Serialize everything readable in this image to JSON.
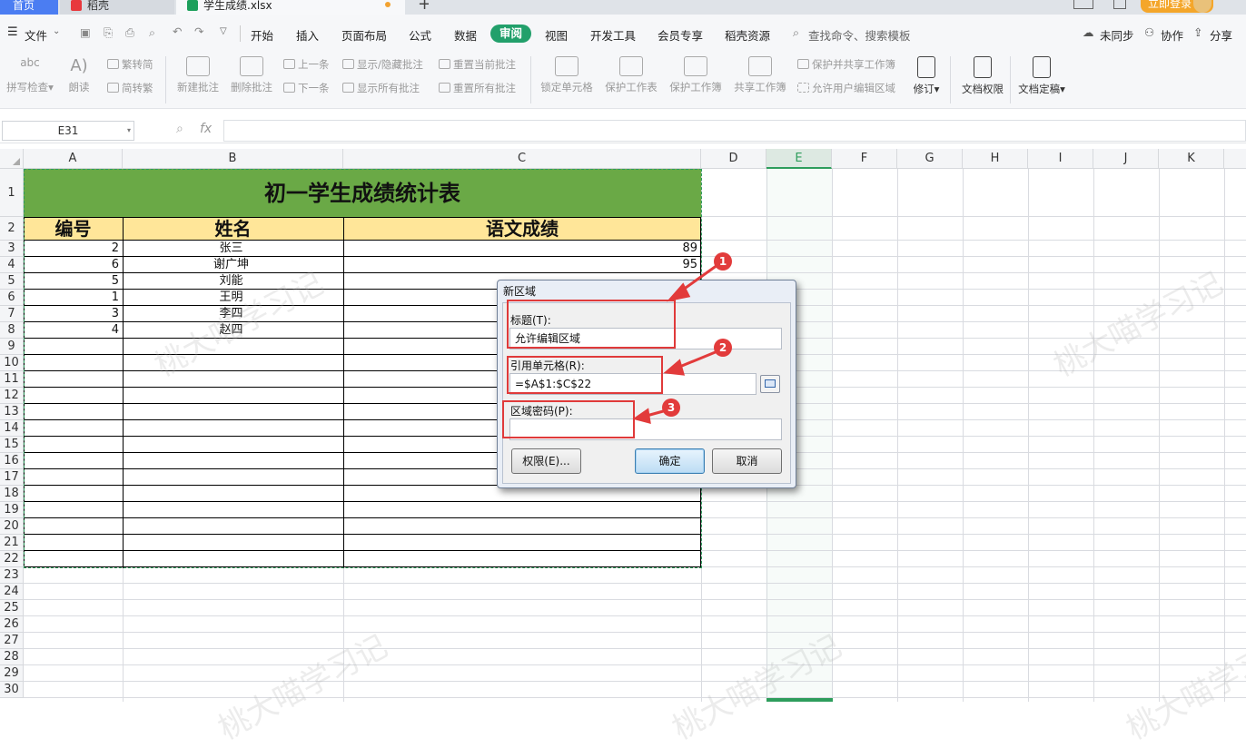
{
  "tabs": {
    "home": "首页",
    "daoke": "稻壳",
    "file": "学生成绩.xlsx",
    "plus": "+"
  },
  "login": "立即登录",
  "menu": {
    "file": "文件",
    "items": [
      "开始",
      "插入",
      "页面布局",
      "公式",
      "数据",
      "审阅",
      "视图",
      "开发工具",
      "会员专享",
      "稻壳资源"
    ],
    "search": "查找命令、搜索模板",
    "sync": "未同步",
    "collab": "协作",
    "share": "分享"
  },
  "ribbon": {
    "spell": "拼写检查",
    "read": "朗读",
    "t2s": "繁转简",
    "s2t": "简转繁",
    "new_comment": "新建批注",
    "del_comment": "删除批注",
    "prev": "上一条",
    "next": "下一条",
    "show_hide": "显示/隐藏批注",
    "show_all": "显示所有批注",
    "reset_cur": "重置当前批注",
    "reset_all": "重置所有批注",
    "lock_cell": "锁定单元格",
    "protect_sheet": "保护工作表",
    "protect_book": "保护工作簿",
    "share_book": "共享工作簿",
    "protect_share": "保护并共享工作簿",
    "allow_edit": "允许用户编辑区域",
    "revise": "修订",
    "doc_perm": "文档权限",
    "doc_final": "文档定稿"
  },
  "formula": {
    "namebox": "E31",
    "fx": "fx"
  },
  "columns": [
    "A",
    "B",
    "C",
    "D",
    "E",
    "F",
    "G",
    "H",
    "I",
    "J",
    "K"
  ],
  "rows": [
    "1",
    "2",
    "3",
    "4",
    "5",
    "6",
    "7",
    "8",
    "9",
    "10",
    "11",
    "12",
    "13",
    "14",
    "15",
    "16",
    "17",
    "18",
    "19",
    "20",
    "21",
    "22",
    "23",
    "24",
    "25",
    "26",
    "27",
    "28",
    "29",
    "30"
  ],
  "sheet": {
    "title": "初一学生成绩统计表",
    "headers": [
      "编号",
      "姓名",
      "语文成绩"
    ],
    "data": [
      {
        "id": "2",
        "name": "张三",
        "score": "89"
      },
      {
        "id": "6",
        "name": "谢广坤",
        "score": "95"
      },
      {
        "id": "5",
        "name": "刘能",
        "score": ""
      },
      {
        "id": "1",
        "name": "王明",
        "score": ""
      },
      {
        "id": "3",
        "name": "李四",
        "score": ""
      },
      {
        "id": "4",
        "name": "赵四",
        "score": ""
      }
    ]
  },
  "dialog": {
    "title": "新区域",
    "title_label": "标题(T):",
    "title_value": "允许编辑区域",
    "ref_label": "引用单元格(R):",
    "ref_value": "=$A$1:$C$22",
    "pwd_label": "区域密码(P):",
    "pwd_value": "",
    "perm_button": "权限(E)...",
    "ok_button": "确定",
    "cancel_button": "取消"
  },
  "annotations": [
    "1",
    "2",
    "3"
  ],
  "watermark": "桃大喵学习记"
}
